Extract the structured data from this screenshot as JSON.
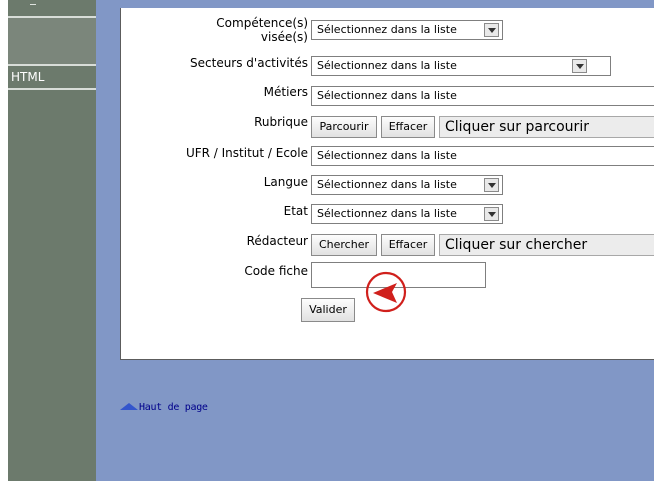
{
  "sidebar": {
    "items": [
      {
        "label": "HTML"
      }
    ]
  },
  "form": {
    "fields": [
      {
        "label_line1": "Compétence(s)",
        "label_line2": "visée(s)",
        "value": "Sélectionnez dans la liste"
      },
      {
        "label": "Secteurs d'activités",
        "value": "Sélectionnez dans la liste"
      },
      {
        "label": "Métiers",
        "value": "Sélectionnez dans la liste"
      },
      {
        "label": "Rubrique",
        "browse": "Parcourir",
        "clear": "Effacer",
        "display": "Cliquer sur parcourir"
      },
      {
        "label": "UFR / Institut / Ecole",
        "value": "Sélectionnez dans la liste"
      },
      {
        "label": "Langue",
        "value": "Sélectionnez dans la liste"
      },
      {
        "label": "Etat",
        "value": "Sélectionnez dans la liste"
      },
      {
        "label": "Rédacteur",
        "search": "Chercher",
        "clear": "Effacer",
        "display": "Cliquer sur chercher"
      },
      {
        "label": "Code fiche",
        "value": ""
      }
    ],
    "submit_label": "Valider"
  },
  "footer": {
    "top_link": "Haut de page"
  },
  "colors": {
    "sidebar": "#6c7a6c",
    "main_background": "#8197c6",
    "cursor_marker": "#d0201c"
  }
}
